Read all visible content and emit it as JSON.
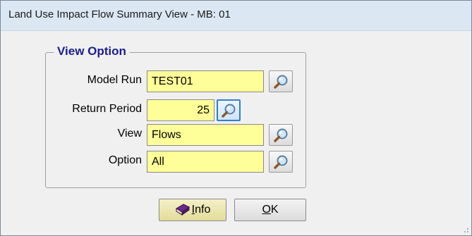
{
  "window": {
    "title": "Land Use Impact Flow Summary View - MB: 01"
  },
  "group": {
    "legend": "View Option",
    "fields": [
      {
        "label": "Model Run",
        "value": "TEST01"
      },
      {
        "label": "Return Period",
        "value": "25"
      },
      {
        "label": "View",
        "value": "Flows"
      },
      {
        "label": "Option",
        "value": "All"
      }
    ]
  },
  "buttons": {
    "info": {
      "label_prefix": "I",
      "label_rest": "nfo"
    },
    "ok": {
      "label_prefix": "O",
      "label_rest": "K"
    }
  },
  "colors": {
    "field_bg": "#ffff99",
    "legend": "#1a1e8c",
    "focus": "#2e7fd1"
  },
  "icons": {
    "lookup": "magnifier-icon",
    "info": "book-icon",
    "grip": "resize-grip-icon"
  }
}
